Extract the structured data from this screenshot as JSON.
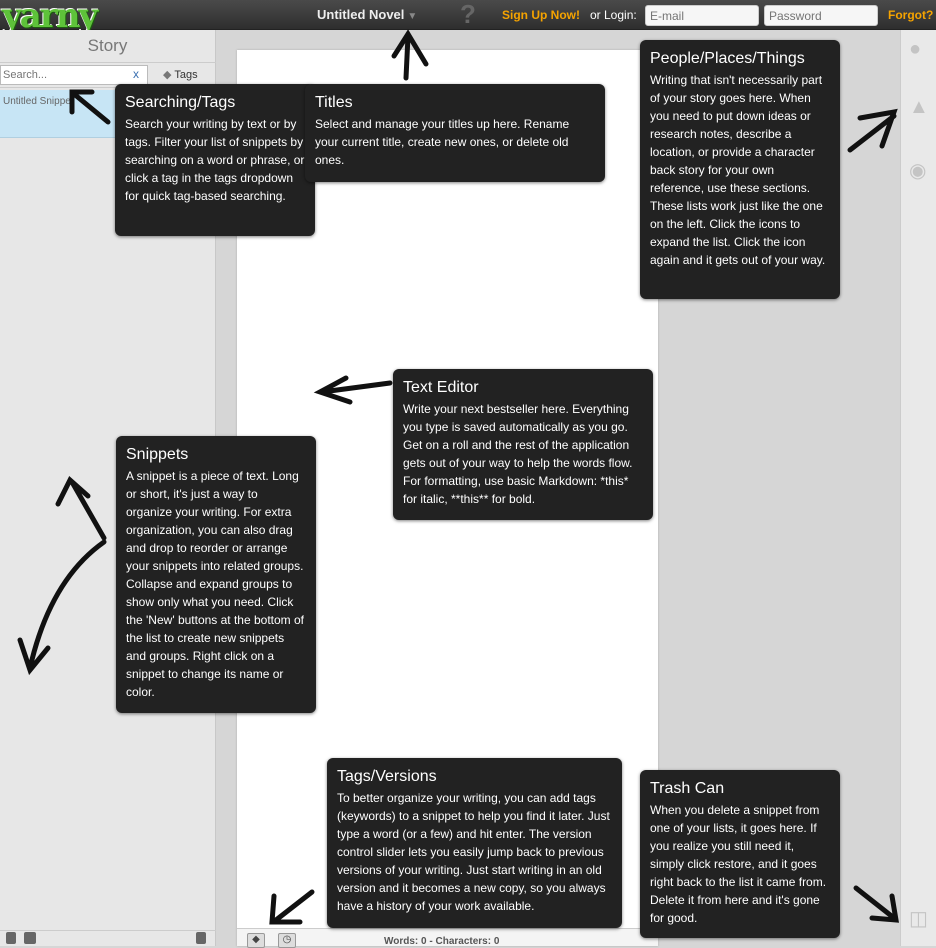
{
  "header": {
    "logo": "yarny",
    "title": "Untitled Novel",
    "title_caret": "▼",
    "help": "?",
    "signup": "Sign Up Now!",
    "or_login": "or Login:",
    "email_placeholder": "E-mail",
    "password_placeholder": "Password",
    "forgot": "Forgot?"
  },
  "sidebar": {
    "heading": "Story",
    "search_placeholder": "Search...",
    "clear": "x",
    "tags_label": "Tags",
    "snippets": [
      {
        "label": "Untitled Snippet"
      }
    ]
  },
  "editor": {
    "status": "Words: 0 - Characters: 0"
  },
  "right_icons": [
    "person-icon",
    "tree-icon",
    "lightbulb-icon",
    "trash-icon"
  ],
  "callouts": {
    "search": {
      "title": "Searching/Tags",
      "body": "Search your writing by text or by tags. Filter your list of snippets by searching on a word or phrase, or click a tag in the tags dropdown for quick tag-based searching."
    },
    "titles": {
      "title": "Titles",
      "body": "Select and manage your titles up here. Rename your current title, create new ones, or delete old ones."
    },
    "people": {
      "title": "People/Places/Things",
      "body": "Writing that isn't necessarily part of your story goes here. When you need to put down ideas or research notes, describe a location, or provide a character back story for your own reference, use these sections. These lists work just like the one on the left. Click the icons to expand the list. Click the icon again and it gets out of your way."
    },
    "editor": {
      "title": "Text Editor",
      "body": "Write your next bestseller here. Everything you type is saved automatically as you go. Get on a roll and the rest of the application gets out of your way to help the words flow. For formatting, use basic Markdown: *this* for italic, **this** for bold."
    },
    "snippets": {
      "title": "Snippets",
      "body": "A snippet is a piece of text. Long or short, it's just a way to organize your writing. For extra organization, you can also drag and drop to reorder or arrange your snippets into related groups. Collapse and expand groups to show only what you need. Click the 'New' buttons at the bottom of the list to create new snippets and groups. Right click on a snippet to change its name or color."
    },
    "tags": {
      "title": "Tags/Versions",
      "body": "To better organize your writing, you can add tags (keywords) to a snippet to help you find it later. Just type a word (or a few) and hit enter. The version control slider lets you easily jump back to previous versions of your writing. Just start writing in an old version and it becomes a new copy, so you always have a history of your work available."
    },
    "trash": {
      "title": "Trash Can",
      "body": "When you delete a snippet from one of your lists, it goes here. If you realize you still need it, simply click restore, and it goes right back to the list it came from. Delete it from here and it's gone for good."
    }
  },
  "colors": {
    "accent": "#f5a300",
    "logo": "#5ec23a",
    "selected_snippet": "#c7e5f5",
    "callout_bg": "#222222"
  }
}
